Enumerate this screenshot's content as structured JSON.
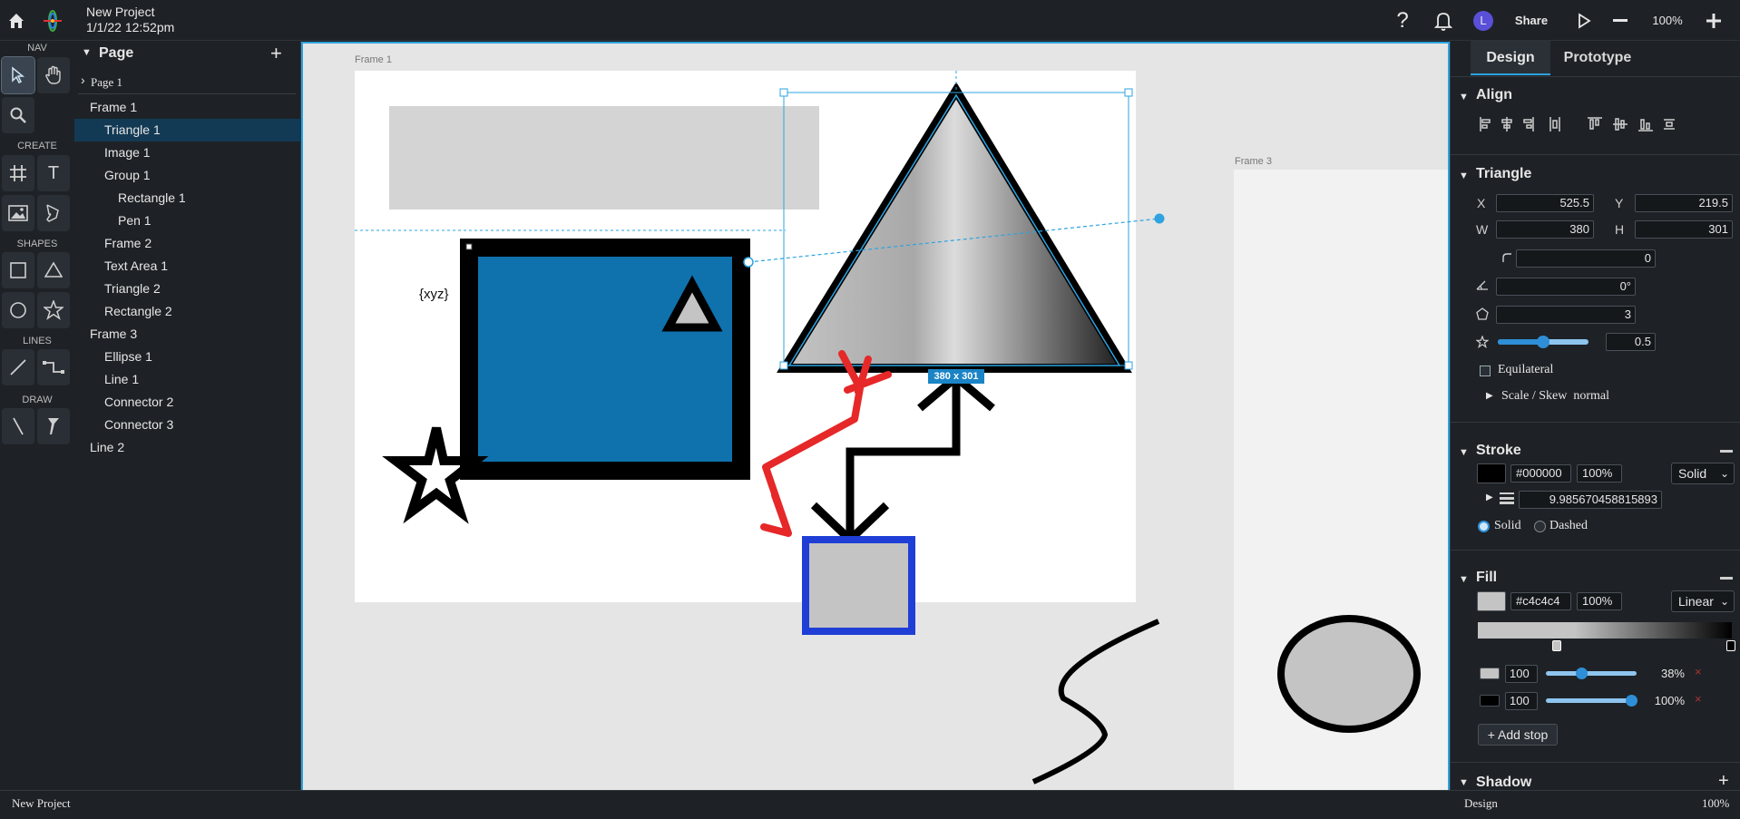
{
  "header": {
    "project_name": "New Project",
    "timestamp": "1/1/22 12:52pm",
    "share_label": "Share",
    "zoom": "100%",
    "avatar_initial": "L"
  },
  "rail": {
    "nav_label": "NAV",
    "create_label": "CREATE",
    "shapes_label": "SHAPES",
    "lines_label": "LINES",
    "draw_label": "DRAW",
    "text_tool_glyph": "T"
  },
  "layers": {
    "title": "Page",
    "page_item": "Page 1",
    "items": [
      {
        "label": "Frame 1",
        "indent": 0
      },
      {
        "label": "Triangle 1",
        "indent": 1
      },
      {
        "label": "Image 1",
        "indent": 1
      },
      {
        "label": "Group 1",
        "indent": 1
      },
      {
        "label": "Rectangle 1",
        "indent": 2
      },
      {
        "label": "Pen 1",
        "indent": 2
      },
      {
        "label": "Frame 2",
        "indent": 1
      },
      {
        "label": "Text Area 1",
        "indent": 1
      },
      {
        "label": "Triangle 2",
        "indent": 1
      },
      {
        "label": "Rectangle 2",
        "indent": 1
      },
      {
        "label": "Frame 3",
        "indent": 0
      },
      {
        "label": "Ellipse 1",
        "indent": 1
      },
      {
        "label": "Line 1",
        "indent": 1
      },
      {
        "label": "Connector 2",
        "indent": 1
      },
      {
        "label": "Connector 3",
        "indent": 1
      },
      {
        "label": "Line 2",
        "indent": 0
      }
    ],
    "selected_index": 1
  },
  "canvas": {
    "frame1_label": "Frame 1",
    "frame3_label": "Frame 3",
    "text_area": "{xyz}",
    "size_badge": "380 x 301"
  },
  "panel": {
    "tabs": [
      "Design",
      "Prototype"
    ],
    "active_tab": "Design",
    "align_title": "Align",
    "triangle_title": "Triangle",
    "x_label": "X",
    "x": "525.5",
    "y_label": "Y",
    "y": "219.5",
    "w_label": "W",
    "w": "380",
    "h_label": "H",
    "h": "301",
    "radius": "0",
    "rotation": "0°",
    "sides": "3",
    "star_ratio": "0.5",
    "star_ratio_level": 0.5,
    "equilateral_label": "Equilateral",
    "scale_skew_label": "Scale / Skew",
    "scale_skew_value": "normal",
    "stroke_title": "Stroke",
    "stroke_color": "#000000",
    "stroke_opacity": "100%",
    "stroke_style": "Solid",
    "stroke_width": "9.985670458815893",
    "solid_label": "Solid",
    "dashed_label": "Dashed",
    "fill_title": "Fill",
    "fill_color": "#c4c4c4",
    "fill_opacity": "100%",
    "fill_type": "Linear",
    "stops": [
      {
        "color": "#c4c4c4",
        "value": "100",
        "position": "38%"
      },
      {
        "color": "#000000",
        "value": "100",
        "position": "100%"
      }
    ],
    "add_stop_label": "+ Add stop",
    "shadow_title": "Shadow"
  },
  "status": {
    "left": "New Project",
    "mode": "Design",
    "zoom": "100%"
  },
  "colors": {
    "accent": "#2ea3e0",
    "selected_layer": "#123a55",
    "blue_rect": "#0f72ad",
    "red_pen": "#e62828",
    "blue_stroke": "#1f3ed6"
  }
}
